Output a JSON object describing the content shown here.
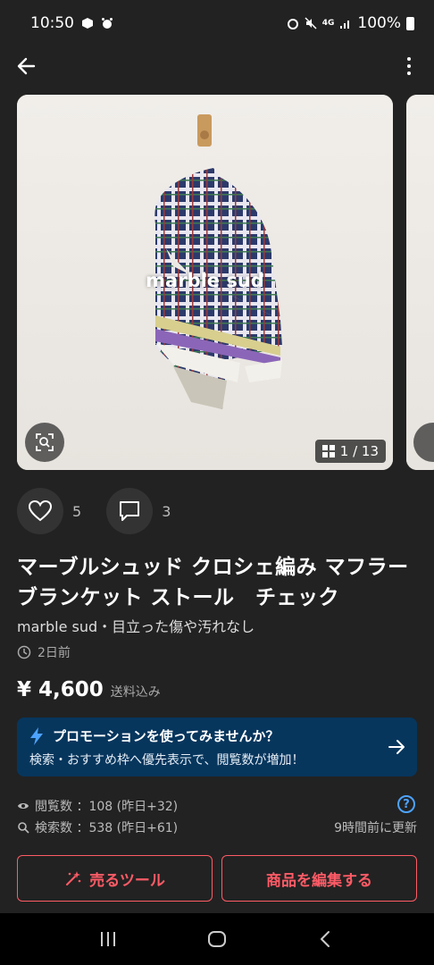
{
  "status_bar": {
    "time": "10:50",
    "battery": "100%",
    "network": "4G"
  },
  "gallery": {
    "watermark": "marble sud",
    "counter": "1 / 13"
  },
  "actions": {
    "like_count": "5",
    "comment_count": "3"
  },
  "product": {
    "title": "マーブルシュッド クロシェ編み マフラー ブランケット ストール　チェック",
    "subtitle": "marble sud・目立った傷や汚れなし",
    "posted": "2日前",
    "price": "¥ 4,600",
    "shipping": "送料込み"
  },
  "promo": {
    "title": "プロモーションを使ってみませんか？",
    "description": "検索・おすすめ枠へ優先表示で、閲覧数が増加！"
  },
  "stats": {
    "views": "閲覧数 ：108 (昨日+32)",
    "searches": "検索数 ：538 (昨日+61)",
    "help": "?",
    "updated": "9時間前に更新"
  },
  "buttons": {
    "sell_tool": "売るツール",
    "edit": "商品を編集する"
  },
  "colors": {
    "background": "#222222",
    "accent": "#ff5b66",
    "promo_bg": "#07365d",
    "help_blue": "#4da3ff"
  }
}
